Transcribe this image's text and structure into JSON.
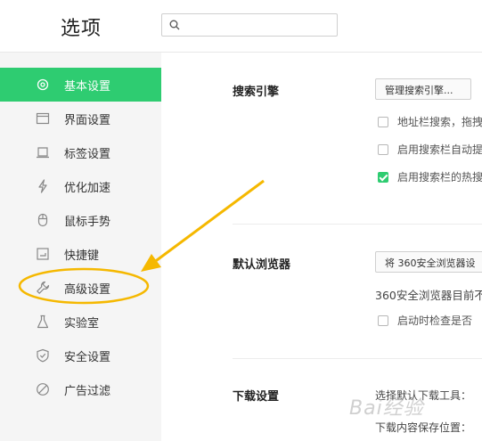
{
  "app": {
    "title": "选项"
  },
  "search": {
    "placeholder": "",
    "value": ""
  },
  "sidebar": {
    "items": [
      {
        "label": "基本设置",
        "icon": "gear-icon",
        "active": true
      },
      {
        "label": "界面设置",
        "icon": "window-icon",
        "active": false
      },
      {
        "label": "标签设置",
        "icon": "tab-icon",
        "active": false
      },
      {
        "label": "优化加速",
        "icon": "lightning-icon",
        "active": false
      },
      {
        "label": "鼠标手势",
        "icon": "mouse-icon",
        "active": false
      },
      {
        "label": "快捷键",
        "icon": "keyboard-icon",
        "active": false
      },
      {
        "label": "高级设置",
        "icon": "wrench-icon",
        "active": false
      },
      {
        "label": "实验室",
        "icon": "flask-icon",
        "active": false
      },
      {
        "label": "安全设置",
        "icon": "shield-icon",
        "active": false
      },
      {
        "label": "广告过滤",
        "icon": "block-icon",
        "active": false
      }
    ]
  },
  "content": {
    "search_engine": {
      "title": "搜索引擎",
      "manage_button": "管理搜索引擎...",
      "options": [
        {
          "label": "地址栏搜索，拖拽",
          "checked": false
        },
        {
          "label": "启用搜索栏自动提",
          "checked": false
        },
        {
          "label": "启用搜索栏的热搜",
          "checked": true
        }
      ]
    },
    "default_browser": {
      "title": "默认浏览器",
      "set_button": "将 360安全浏览器设",
      "status_text": "360安全浏览器目前不",
      "option": {
        "label": "启动时检查是否",
        "checked": false
      }
    },
    "download": {
      "title": "下载设置",
      "tool_label": "选择默认下载工具：",
      "path_label": "下载内容保存位置："
    }
  },
  "annotation": {
    "color": "#f5b800"
  },
  "colors": {
    "accent": "#2ecc71"
  },
  "watermark": "Bai经验"
}
